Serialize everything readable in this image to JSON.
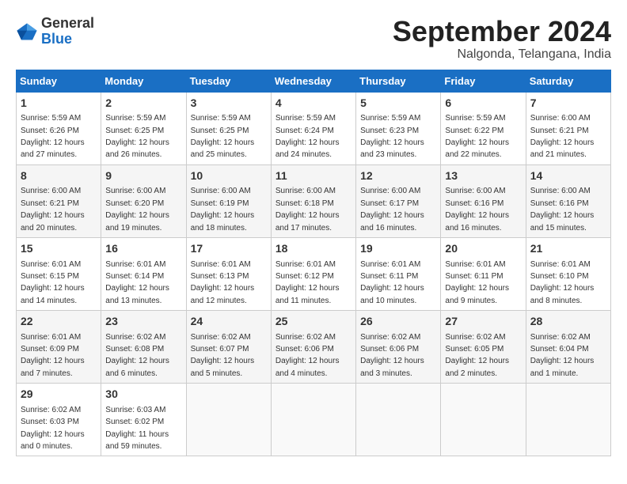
{
  "header": {
    "logo_line1": "General",
    "logo_line2": "Blue",
    "month_title": "September 2024",
    "subtitle": "Nalgonda, Telangana, India"
  },
  "days_of_week": [
    "Sunday",
    "Monday",
    "Tuesday",
    "Wednesday",
    "Thursday",
    "Friday",
    "Saturday"
  ],
  "weeks": [
    [
      {
        "day": "1",
        "sunrise": "5:59 AM",
        "sunset": "6:26 PM",
        "daylight": "12 hours and 27 minutes."
      },
      {
        "day": "2",
        "sunrise": "5:59 AM",
        "sunset": "6:25 PM",
        "daylight": "12 hours and 26 minutes."
      },
      {
        "day": "3",
        "sunrise": "5:59 AM",
        "sunset": "6:25 PM",
        "daylight": "12 hours and 25 minutes."
      },
      {
        "day": "4",
        "sunrise": "5:59 AM",
        "sunset": "6:24 PM",
        "daylight": "12 hours and 24 minutes."
      },
      {
        "day": "5",
        "sunrise": "5:59 AM",
        "sunset": "6:23 PM",
        "daylight": "12 hours and 23 minutes."
      },
      {
        "day": "6",
        "sunrise": "5:59 AM",
        "sunset": "6:22 PM",
        "daylight": "12 hours and 22 minutes."
      },
      {
        "day": "7",
        "sunrise": "6:00 AM",
        "sunset": "6:21 PM",
        "daylight": "12 hours and 21 minutes."
      }
    ],
    [
      {
        "day": "8",
        "sunrise": "6:00 AM",
        "sunset": "6:21 PM",
        "daylight": "12 hours and 20 minutes."
      },
      {
        "day": "9",
        "sunrise": "6:00 AM",
        "sunset": "6:20 PM",
        "daylight": "12 hours and 19 minutes."
      },
      {
        "day": "10",
        "sunrise": "6:00 AM",
        "sunset": "6:19 PM",
        "daylight": "12 hours and 18 minutes."
      },
      {
        "day": "11",
        "sunrise": "6:00 AM",
        "sunset": "6:18 PM",
        "daylight": "12 hours and 17 minutes."
      },
      {
        "day": "12",
        "sunrise": "6:00 AM",
        "sunset": "6:17 PM",
        "daylight": "12 hours and 16 minutes."
      },
      {
        "day": "13",
        "sunrise": "6:00 AM",
        "sunset": "6:16 PM",
        "daylight": "12 hours and 16 minutes."
      },
      {
        "day": "14",
        "sunrise": "6:00 AM",
        "sunset": "6:16 PM",
        "daylight": "12 hours and 15 minutes."
      }
    ],
    [
      {
        "day": "15",
        "sunrise": "6:01 AM",
        "sunset": "6:15 PM",
        "daylight": "12 hours and 14 minutes."
      },
      {
        "day": "16",
        "sunrise": "6:01 AM",
        "sunset": "6:14 PM",
        "daylight": "12 hours and 13 minutes."
      },
      {
        "day": "17",
        "sunrise": "6:01 AM",
        "sunset": "6:13 PM",
        "daylight": "12 hours and 12 minutes."
      },
      {
        "day": "18",
        "sunrise": "6:01 AM",
        "sunset": "6:12 PM",
        "daylight": "12 hours and 11 minutes."
      },
      {
        "day": "19",
        "sunrise": "6:01 AM",
        "sunset": "6:11 PM",
        "daylight": "12 hours and 10 minutes."
      },
      {
        "day": "20",
        "sunrise": "6:01 AM",
        "sunset": "6:11 PM",
        "daylight": "12 hours and 9 minutes."
      },
      {
        "day": "21",
        "sunrise": "6:01 AM",
        "sunset": "6:10 PM",
        "daylight": "12 hours and 8 minutes."
      }
    ],
    [
      {
        "day": "22",
        "sunrise": "6:01 AM",
        "sunset": "6:09 PM",
        "daylight": "12 hours and 7 minutes."
      },
      {
        "day": "23",
        "sunrise": "6:02 AM",
        "sunset": "6:08 PM",
        "daylight": "12 hours and 6 minutes."
      },
      {
        "day": "24",
        "sunrise": "6:02 AM",
        "sunset": "6:07 PM",
        "daylight": "12 hours and 5 minutes."
      },
      {
        "day": "25",
        "sunrise": "6:02 AM",
        "sunset": "6:06 PM",
        "daylight": "12 hours and 4 minutes."
      },
      {
        "day": "26",
        "sunrise": "6:02 AM",
        "sunset": "6:06 PM",
        "daylight": "12 hours and 3 minutes."
      },
      {
        "day": "27",
        "sunrise": "6:02 AM",
        "sunset": "6:05 PM",
        "daylight": "12 hours and 2 minutes."
      },
      {
        "day": "28",
        "sunrise": "6:02 AM",
        "sunset": "6:04 PM",
        "daylight": "12 hours and 1 minute."
      }
    ],
    [
      {
        "day": "29",
        "sunrise": "6:02 AM",
        "sunset": "6:03 PM",
        "daylight": "12 hours and 0 minutes."
      },
      {
        "day": "30",
        "sunrise": "6:03 AM",
        "sunset": "6:02 PM",
        "daylight": "11 hours and 59 minutes."
      },
      null,
      null,
      null,
      null,
      null
    ]
  ]
}
